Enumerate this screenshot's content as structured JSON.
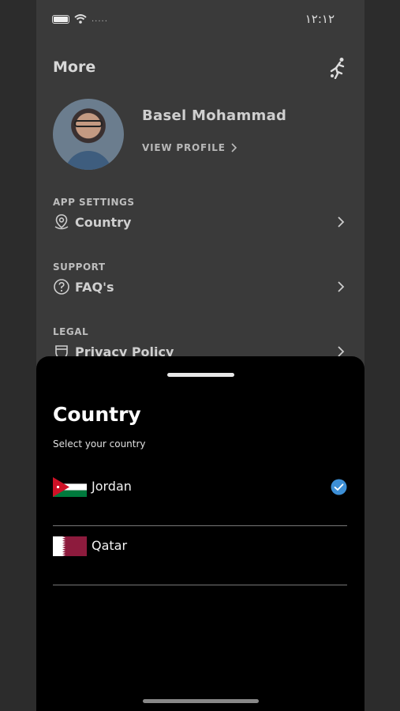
{
  "status_bar": {
    "time": "١٢:١٢",
    "carrier": "....."
  },
  "header": {
    "title": "More"
  },
  "profile": {
    "name": "Basel Mohammad",
    "view_profile": "VIEW PROFILE"
  },
  "sections": [
    {
      "label": "APP SETTINGS",
      "item": "Country",
      "icon": "location-pin-icon"
    },
    {
      "label": "SUPPORT",
      "item": "FAQ's",
      "icon": "question-icon"
    },
    {
      "label": "LEGAL",
      "item": "Privacy Policy",
      "icon": "shield-icon"
    }
  ],
  "sheet": {
    "title": "Country",
    "subtitle": "Select your country",
    "countries": [
      {
        "name": "Jordan",
        "flag": "jordan-flag",
        "selected": true
      },
      {
        "name": "Qatar",
        "flag": "qatar-flag",
        "selected": false
      }
    ]
  },
  "colors": {
    "accent": "#3d8fd6",
    "sheet_bg": "#000000",
    "page_bg": "#3a3a3a"
  }
}
